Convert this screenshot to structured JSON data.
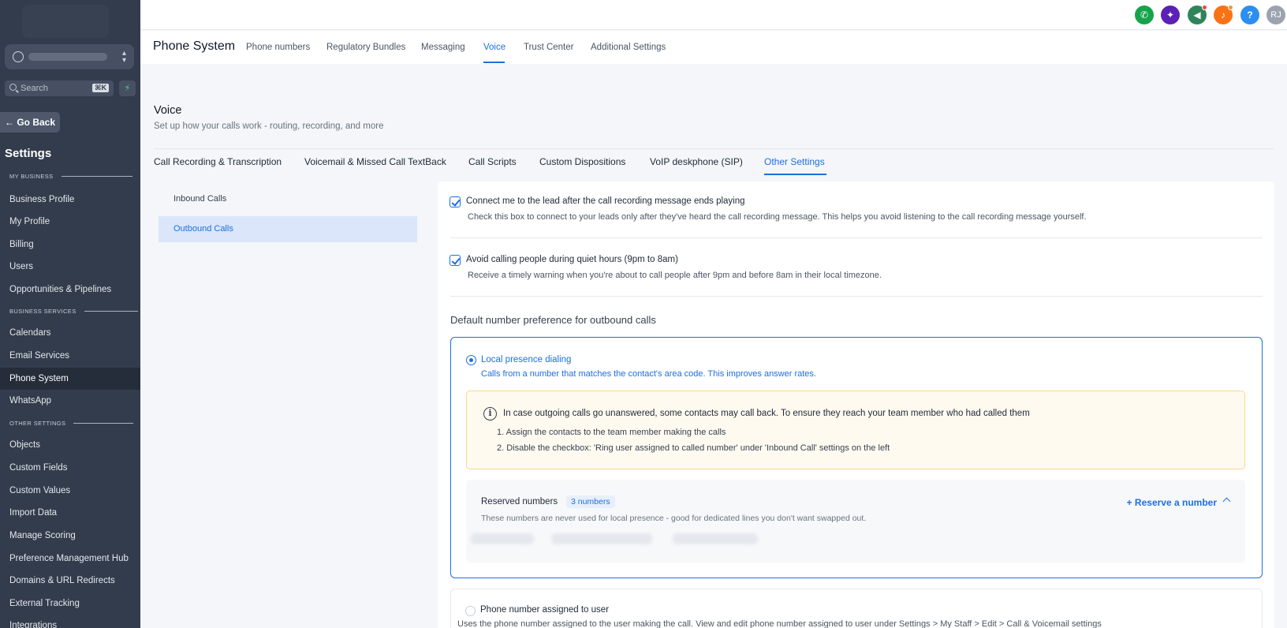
{
  "sidebar": {
    "search": {
      "placeholder": "Search",
      "shortcut": "⌘K"
    },
    "go_back": "Go Back",
    "title": "Settings",
    "sections": {
      "my_business": "MY BUSINESS",
      "business_services": "BUSINESS SERVICES",
      "other_settings": "OTHER SETTINGS"
    },
    "items": [
      "Business Profile",
      "My Profile",
      "Billing",
      "Users",
      "Opportunities & Pipelines",
      "Calendars",
      "Email Services",
      "Phone System",
      "WhatsApp",
      "Objects",
      "Custom Fields",
      "Custom Values",
      "Import Data",
      "Manage Scoring",
      "Preference Management Hub",
      "Domains & URL Redirects",
      "External Tracking",
      "Integrations"
    ],
    "active_item": "Phone System"
  },
  "topbar": {
    "icons": [
      {
        "name": "phone-icon",
        "glyph": "✆",
        "color": "#16a34a"
      },
      {
        "name": "ai-sparkle-icon",
        "glyph": "✦",
        "color": "#5b21b6"
      },
      {
        "name": "megaphone-icon",
        "glyph": "◀",
        "color": "#2f855a"
      },
      {
        "name": "bell-icon",
        "glyph": "♪",
        "color": "#f97316"
      },
      {
        "name": "help-icon",
        "glyph": "?",
        "color": "#2b8ff0"
      }
    ],
    "avatar": {
      "initials": "RJ",
      "color": "#9ca3af"
    }
  },
  "subnav": {
    "title": "Phone System",
    "tabs": [
      "Phone numbers",
      "Regulatory Bundles",
      "Messaging",
      "Voice",
      "Trust Center",
      "Additional Settings"
    ],
    "active_tab": "Voice"
  },
  "voice": {
    "title": "Voice",
    "subtitle": "Set up how your calls work - routing, recording, and more",
    "tabs": [
      "Call Recording & Transcription",
      "Voicemail & Missed Call TextBack",
      "Call Scripts",
      "Custom Dispositions",
      "VoIP deskphone (SIP)",
      "Other Settings"
    ],
    "active_tab": "Other Settings"
  },
  "left_nav": {
    "items": [
      "Inbound Calls",
      "Outbound Calls"
    ],
    "active": "Outbound Calls"
  },
  "options": {
    "connect_after_recording": {
      "checked": true,
      "title": "Connect me to the lead after the call recording message ends playing",
      "desc": "Check this box to connect to your leads only after they've heard the call recording message. This helps you avoid listening to the call recording message yourself."
    },
    "quiet_hours": {
      "checked": true,
      "title": "Avoid calling people during quiet hours (9pm to 8am)",
      "desc": "Receive a timely warning when you're about to call people after 9pm and before 8am in their local timezone."
    }
  },
  "default_number": {
    "heading": "Default number preference for outbound calls",
    "local_presence": {
      "selected": true,
      "title": "Local presence dialing",
      "desc": "Calls from a number that matches the contact's area code. This improves answer rates.",
      "warning": {
        "text": "In case outgoing calls go unanswered, some contacts may call back. To ensure they reach your team member who had called them",
        "steps": [
          "1. Assign the contacts to the team member making the calls",
          "2. Disable the checkbox: 'Ring user assigned to called number' under 'Inbound Call' settings on the left"
        ]
      },
      "reserved": {
        "title": "Reserved numbers",
        "badge": "3 numbers",
        "link": "+ Reserve a number",
        "desc": "These numbers are never used for local presence - good for dedicated lines you don't want swapped out."
      }
    },
    "assigned_to_user": {
      "selected": false,
      "title": "Phone number assigned to user",
      "desc": "Uses the phone number assigned to the user making the call. View and edit phone number assigned to user under Settings > My Staff > Edit > Call & Voicemail settings"
    }
  }
}
